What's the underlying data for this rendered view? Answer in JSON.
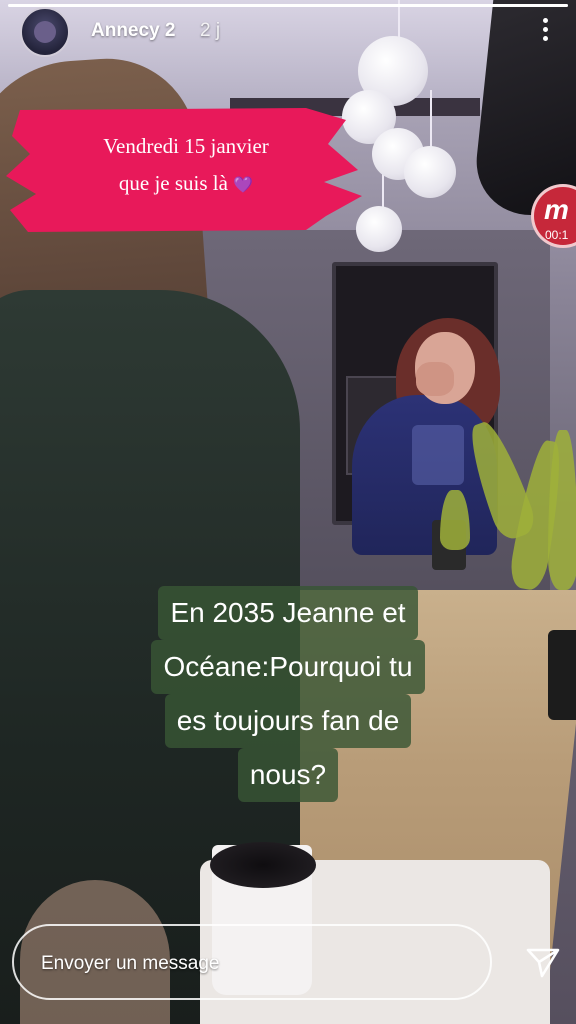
{
  "story": {
    "progress_fraction": 1.0,
    "account_name": "Annecy 2",
    "posted_ago": "2 j",
    "more_icon": "more-vertical-icon"
  },
  "sticker": {
    "line1": "Vendredi 15 janvier",
    "line2": "que je suis là",
    "emoji": "💜",
    "color": "#e8195a"
  },
  "badge": {
    "letter": "m",
    "time": "00:1",
    "color": "#c6283a"
  },
  "caption": {
    "lines": [
      "En 2035 Jeanne et",
      "Océane:Pourquoi tu",
      "es toujours fan de",
      "nous?"
    ],
    "background": "#385634"
  },
  "reply": {
    "placeholder": "Envoyer un message",
    "send_icon": "send-icon"
  }
}
